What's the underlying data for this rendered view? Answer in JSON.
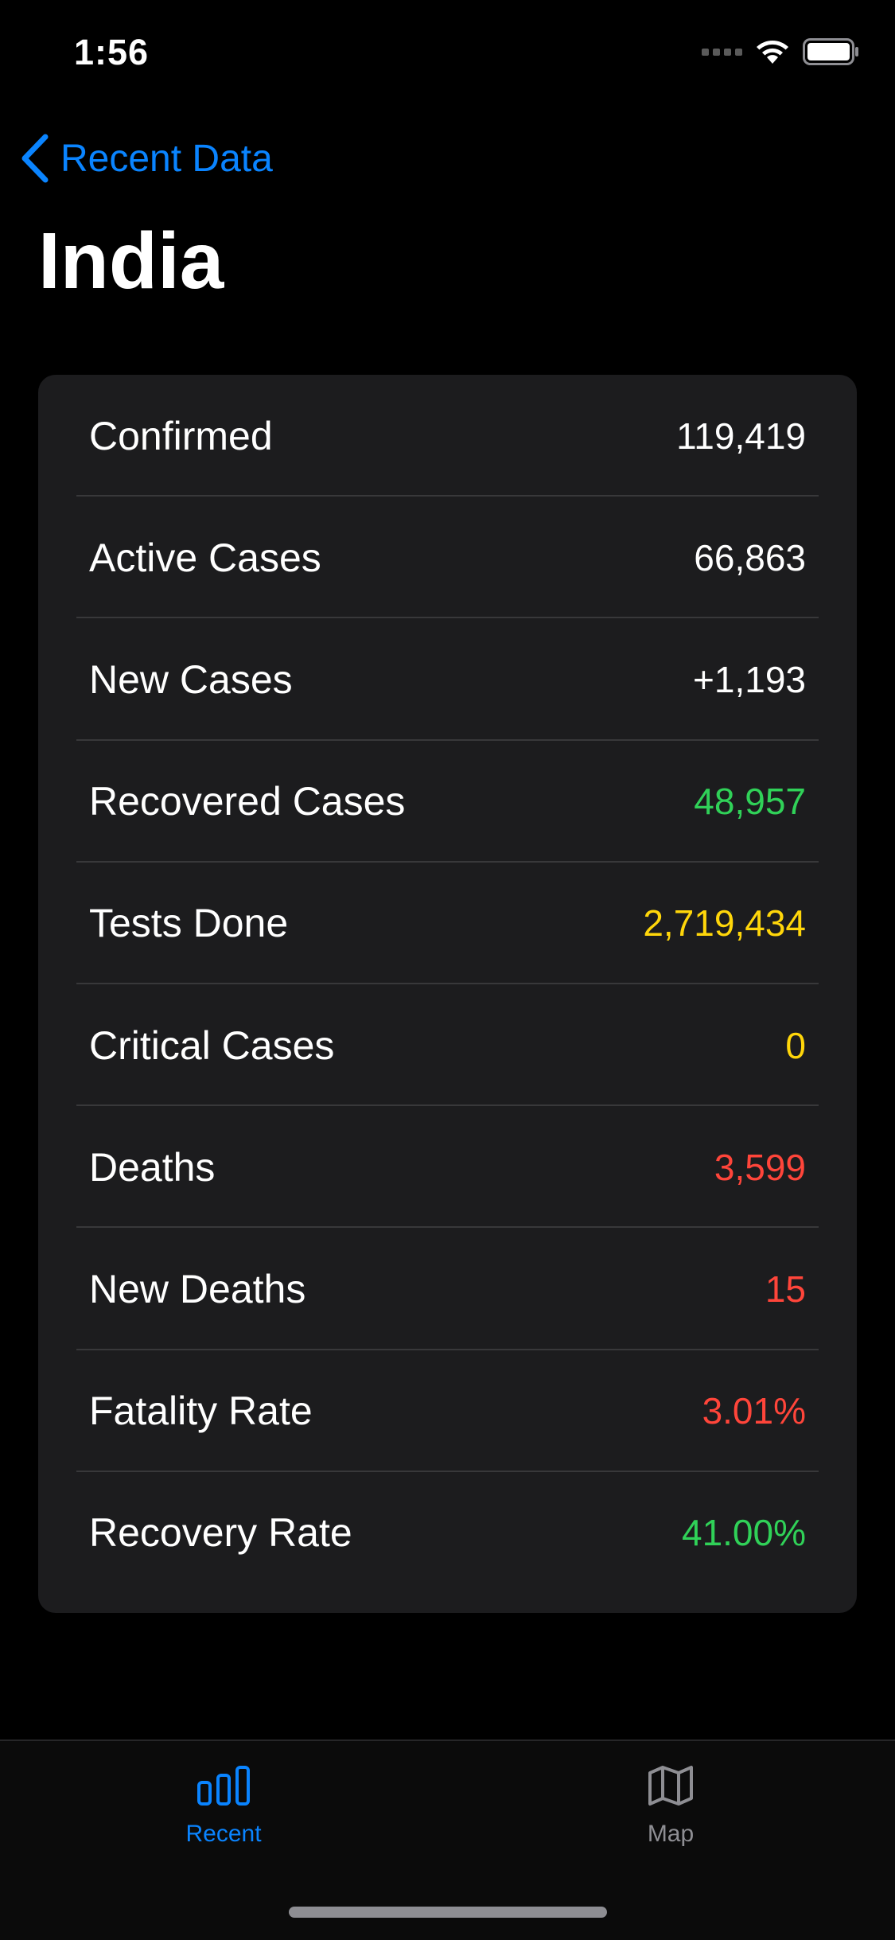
{
  "status_bar": {
    "time": "1:56"
  },
  "nav": {
    "back_label": "Recent Data"
  },
  "page": {
    "title": "India"
  },
  "stats": [
    {
      "label": "Confirmed",
      "value": "119,419",
      "color": "#ffffff"
    },
    {
      "label": "Active Cases",
      "value": "66,863",
      "color": "#ffffff"
    },
    {
      "label": "New Cases",
      "value": "+1,193",
      "color": "#ffffff"
    },
    {
      "label": "Recovered Cases",
      "value": "48,957",
      "color": "#30d158"
    },
    {
      "label": "Tests Done",
      "value": "2,719,434",
      "color": "#ffd60a"
    },
    {
      "label": "Critical Cases",
      "value": "0",
      "color": "#ffd60a"
    },
    {
      "label": "Deaths",
      "value": "3,599",
      "color": "#ff453a"
    },
    {
      "label": "New Deaths",
      "value": "15",
      "color": "#ff453a"
    },
    {
      "label": "Fatality Rate",
      "value": "3.01%",
      "color": "#ff453a"
    },
    {
      "label": "Recovery Rate",
      "value": "41.00%",
      "color": "#30d158"
    }
  ],
  "tab_bar": {
    "tabs": [
      {
        "label": "Recent",
        "icon": "bar-chart-icon",
        "selected": true,
        "color": "#0a84ff"
      },
      {
        "label": "Map",
        "icon": "map-icon",
        "selected": false,
        "color": "#8e8e93"
      }
    ]
  },
  "colors": {
    "accent": "#0a84ff",
    "card_background": "#1c1c1e",
    "page_background": "#000000"
  }
}
